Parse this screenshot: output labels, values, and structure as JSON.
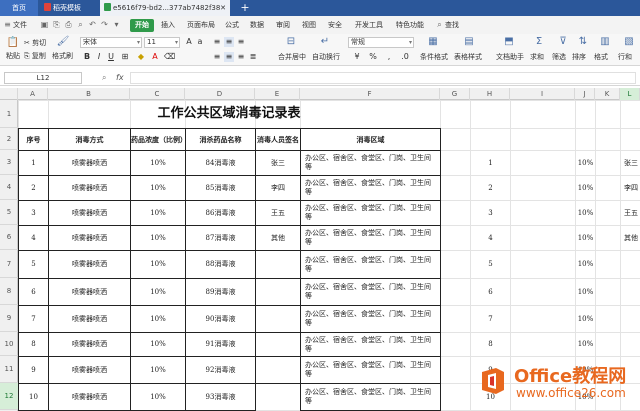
{
  "tabs": {
    "home": "首页",
    "template": "稻壳模板",
    "file": "e5616f79-bd2...377ab7482f38",
    "plus": "+"
  },
  "menu": {
    "items": [
      "文件",
      "开始",
      "插入",
      "页面布局",
      "公式",
      "数据",
      "审阅",
      "视图",
      "安全",
      "开发工具",
      "特色功能"
    ],
    "active": "开始",
    "search": "查找"
  },
  "ribbon": {
    "cut": "剪切",
    "copy": "复制",
    "format_painter": "格式刷",
    "paste": "粘贴",
    "font_name": "宋体",
    "font_size": "11",
    "merge_center": "合并居中",
    "wrap_text": "自动换行",
    "number_format": "常规",
    "conditional_format": "条件格式",
    "table_style": "表格样式",
    "doc_helper": "文档助手",
    "sum": "求和",
    "filter": "筛选",
    "sort": "排序",
    "format": "格式",
    "rows_cols": "行和"
  },
  "formula_bar": {
    "cell_ref": "L12",
    "fx": "fx",
    "value": ""
  },
  "columns": [
    "A",
    "B",
    "C",
    "D",
    "E",
    "F",
    "G",
    "H",
    "I",
    "J",
    "K",
    "L"
  ],
  "selected_column": "L",
  "rows": [
    "1",
    "2",
    "3",
    "4",
    "5",
    "6",
    "7",
    "8",
    "9",
    "10",
    "11",
    "12"
  ],
  "selected_row": "12",
  "sheet": {
    "title": "工作公共区域消毒记录表",
    "headers": {
      "seq": "序号",
      "method": "消毒方式",
      "concentration": "药品浓度（比例）",
      "drug": "消杀药品名称",
      "person": "消毒人员签名",
      "area": "消毒区域"
    },
    "records": [
      {
        "seq": "1",
        "method": "喷雾器喷洒",
        "conc": "10%",
        "drug": "84消毒液",
        "area": "办公区、宿舍区、食堂区、门岗、卫生间等"
      },
      {
        "seq": "2",
        "method": "喷雾器喷洒",
        "conc": "10%",
        "drug": "85消毒液",
        "area": "办公区、宿舍区、食堂区、门岗、卫生间等"
      },
      {
        "seq": "3",
        "method": "喷雾器喷洒",
        "conc": "10%",
        "drug": "86消毒液",
        "area": "办公区、宿舍区、食堂区、门岗、卫生间等"
      },
      {
        "seq": "4",
        "method": "喷雾器喷洒",
        "conc": "10%",
        "drug": "87消毒液",
        "area": "办公区、宿舍区、食堂区、门岗、卫生间等"
      },
      {
        "seq": "5",
        "method": "喷雾器喷洒",
        "conc": "10%",
        "drug": "88消毒液",
        "area": "办公区、宿舍区、食堂区、门岗、卫生间等"
      },
      {
        "seq": "6",
        "method": "喷雾器喷洒",
        "conc": "10%",
        "drug": "89消毒液",
        "area": "办公区、宿舍区、食堂区、门岗、卫生间等"
      },
      {
        "seq": "7",
        "method": "喷雾器喷洒",
        "conc": "10%",
        "drug": "90消毒液",
        "area": "办公区、宿舍区、食堂区、门岗、卫生间等"
      },
      {
        "seq": "8",
        "method": "喷雾器喷洒",
        "conc": "10%",
        "drug": "91消毒液",
        "area": "办公区、宿舍区、食堂区、门岗、卫生间等"
      },
      {
        "seq": "9",
        "method": "喷雾器喷洒",
        "conc": "10%",
        "drug": "92消毒液",
        "area": "办公区、宿舍区、食堂区、门岗、卫生间等"
      },
      {
        "seq": "10",
        "method": "喷雾器喷洒",
        "conc": "10%",
        "drug": "93消毒液",
        "area": "办公区、宿舍区、食堂区、门岗、卫生间等"
      }
    ],
    "persons": [
      "张三",
      "李四",
      "王五",
      "其他"
    ],
    "helper_h": [
      "1",
      "2",
      "3",
      "4",
      "5",
      "6",
      "7",
      "8",
      "9",
      "10"
    ],
    "helper_j": [
      "10%",
      "10%",
      "10%",
      "10%",
      "10%",
      "10%",
      "10%",
      "10%",
      "10%",
      "10%"
    ],
    "helper_l": [
      "张三",
      "李四",
      "王五",
      "其他"
    ]
  },
  "watermark": {
    "brand": "Office教程网",
    "url": "www.office26.com",
    "colors": {
      "orange": "#e8681f",
      "red": "#d9332b"
    }
  }
}
